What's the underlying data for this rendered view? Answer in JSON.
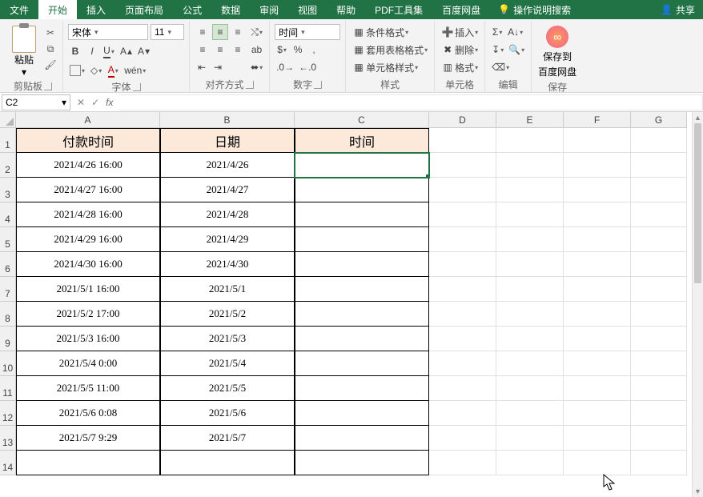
{
  "tabs": {
    "file": "文件",
    "home": "开始",
    "insert": "插入",
    "layout": "页面布局",
    "formula": "公式",
    "data": "数据",
    "review": "审阅",
    "view": "视图",
    "help": "帮助",
    "pdf": "PDF工具集",
    "baidu": "百度网盘",
    "tellme": "操作说明搜索",
    "share": "共享"
  },
  "ribbon": {
    "clipboard": {
      "paste": "粘贴",
      "label": "剪贴板"
    },
    "font": {
      "name": "宋体",
      "size": "11",
      "label": "字体"
    },
    "align": {
      "label": "对齐方式",
      "wrap": "ab"
    },
    "number": {
      "format": "时间",
      "label": "数字"
    },
    "styles": {
      "cond": "条件格式",
      "table": "套用表格格式",
      "cell": "单元格样式",
      "label": "样式"
    },
    "cells": {
      "insert": "插入",
      "delete": "删除",
      "format": "格式",
      "label": "单元格"
    },
    "editing": {
      "label": "编辑"
    },
    "save": {
      "line1": "保存到",
      "line2": "百度网盘",
      "label": "保存"
    }
  },
  "namebox": "C2",
  "columns": [
    "A",
    "B",
    "C",
    "D",
    "E",
    "F",
    "G"
  ],
  "headers": {
    "a": "付款时间",
    "b": "日期",
    "c": "时间"
  },
  "chart_data": {
    "type": "table",
    "columns": [
      "付款时间",
      "日期",
      "时间"
    ],
    "rows": [
      [
        "2021/4/26 16:00",
        "2021/4/26",
        ""
      ],
      [
        "2021/4/27 16:00",
        "2021/4/27",
        ""
      ],
      [
        "2021/4/28 16:00",
        "2021/4/28",
        ""
      ],
      [
        "2021/4/29 16:00",
        "2021/4/29",
        ""
      ],
      [
        "2021/4/30 16:00",
        "2021/4/30",
        ""
      ],
      [
        "2021/5/1 16:00",
        "2021/5/1",
        ""
      ],
      [
        "2021/5/2 17:00",
        "2021/5/2",
        ""
      ],
      [
        "2021/5/3 16:00",
        "2021/5/3",
        ""
      ],
      [
        "2021/5/4 0:00",
        "2021/5/4",
        ""
      ],
      [
        "2021/5/5 11:00",
        "2021/5/5",
        ""
      ],
      [
        "2021/5/6 0:08",
        "2021/5/6",
        ""
      ],
      [
        "2021/5/7 9:29",
        "2021/5/7",
        ""
      ]
    ]
  }
}
